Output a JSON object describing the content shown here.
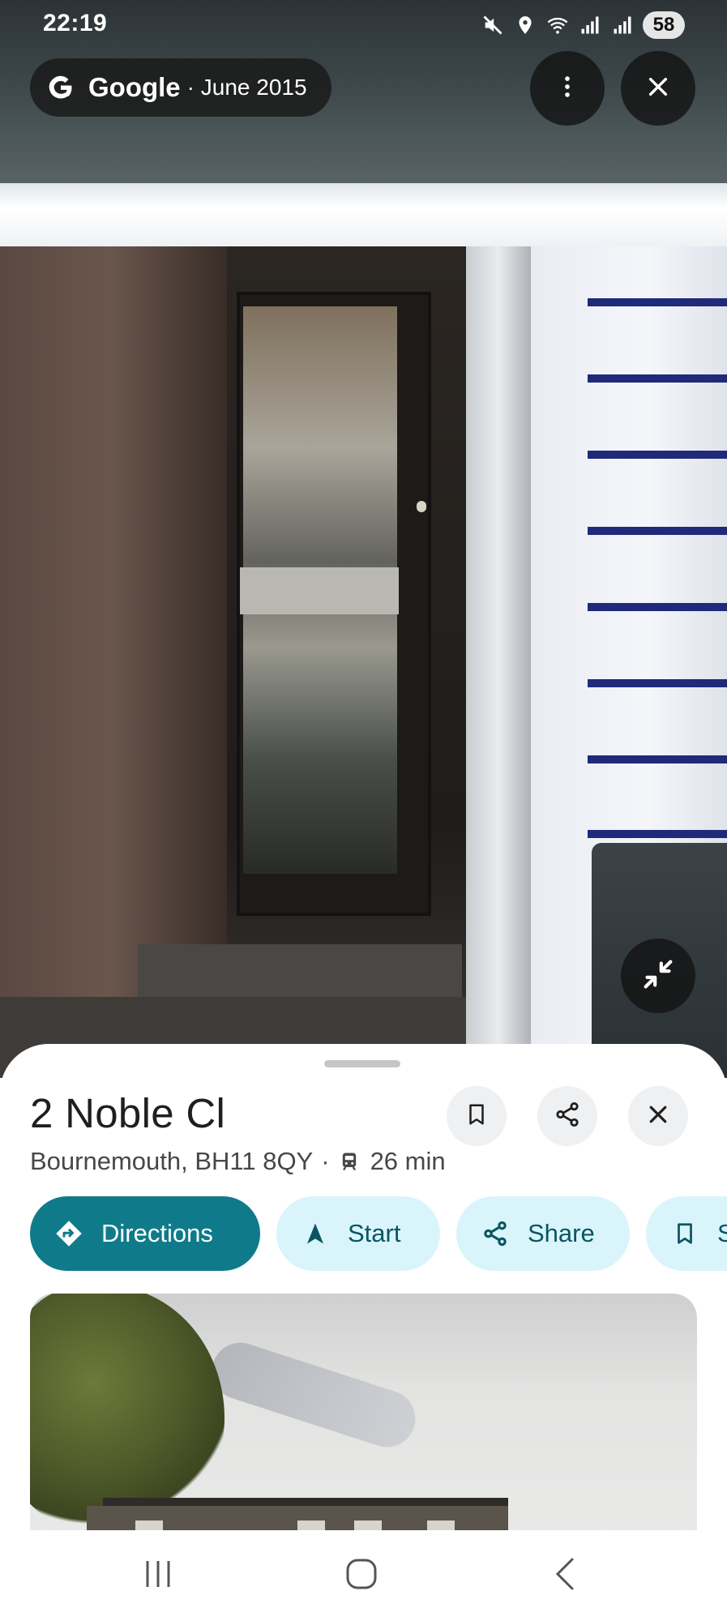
{
  "status_bar": {
    "time": "22:19",
    "icons": [
      "mute-icon",
      "location-icon",
      "wifi-icon",
      "signal-icon",
      "signal-icon"
    ],
    "battery": "58"
  },
  "street_view": {
    "attribution_brand": "Google",
    "attribution_date": "· June 2015",
    "more_icon": "more-vert-icon",
    "close_icon": "close-icon",
    "minimize_icon": "minimize-icon"
  },
  "place": {
    "title": "2 Noble Cl",
    "address": "Bournemouth, BH11 8QY",
    "separator": "·",
    "transit_time": "26 min"
  },
  "actions": {
    "directions": "Directions",
    "start": "Start",
    "share": "Share",
    "save": "S"
  },
  "colors": {
    "primary": "#0f7b8a",
    "chip_bg": "#d9f5fb",
    "chip_text": "#0b5563"
  }
}
